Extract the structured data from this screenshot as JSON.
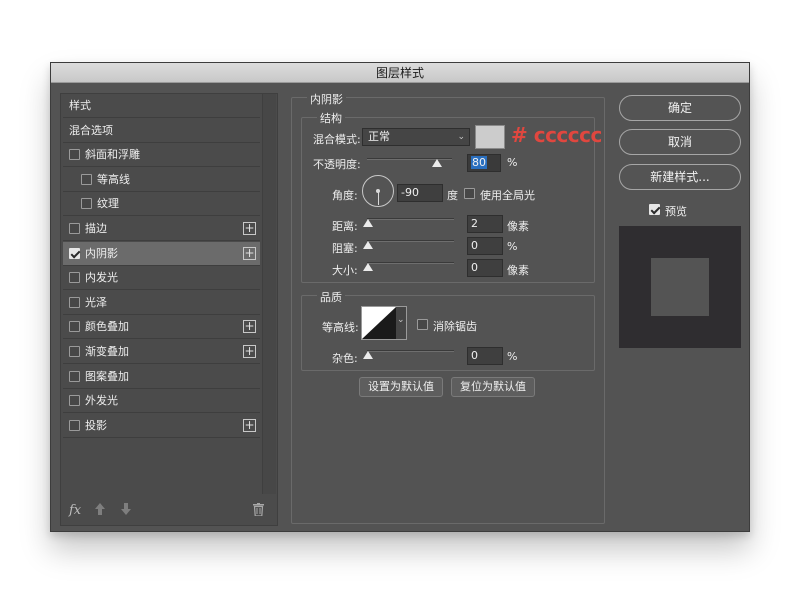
{
  "dialog": {
    "title": "图层样式"
  },
  "left_panel": {
    "items": [
      {
        "label": "样式",
        "checkbox": false,
        "plus": false
      },
      {
        "label": "混合选项",
        "checkbox": false,
        "plus": false
      },
      {
        "label": "斜面和浮雕",
        "checkbox": true,
        "checked": false,
        "plus": false
      },
      {
        "label": "等高线",
        "checkbox": true,
        "checked": false,
        "plus": false,
        "indent": true
      },
      {
        "label": "纹理",
        "checkbox": true,
        "checked": false,
        "plus": false,
        "indent": true
      },
      {
        "label": "描边",
        "checkbox": true,
        "checked": false,
        "plus": true
      },
      {
        "label": "内阴影",
        "checkbox": true,
        "checked": true,
        "plus": true,
        "selected": true
      },
      {
        "label": "内发光",
        "checkbox": true,
        "checked": false,
        "plus": false
      },
      {
        "label": "光泽",
        "checkbox": true,
        "checked": false,
        "plus": false
      },
      {
        "label": "颜色叠加",
        "checkbox": true,
        "checked": false,
        "plus": true
      },
      {
        "label": "渐变叠加",
        "checkbox": true,
        "checked": false,
        "plus": true
      },
      {
        "label": "图案叠加",
        "checkbox": true,
        "checked": false,
        "plus": false
      },
      {
        "label": "外发光",
        "checkbox": true,
        "checked": false,
        "plus": false
      },
      {
        "label": "投影",
        "checkbox": true,
        "checked": false,
        "plus": true
      }
    ],
    "fx_label": "fx",
    "icons": [
      "fx-icon",
      "move-up-icon",
      "move-down-icon",
      "trash-icon"
    ]
  },
  "inner_shadow": {
    "section_title": "内阴影",
    "structure_title": "结构",
    "blend_mode_label": "混合模式:",
    "blend_mode_value": "正常",
    "color_swatch": "#cccccc",
    "color_annotation": "# cccccc",
    "opacity_label": "不透明度:",
    "opacity_value": "80",
    "opacity": 80,
    "opacity_unit": "%",
    "angle_label": "角度:",
    "angle_value": "-90",
    "angle_unit": "度",
    "global_light_label": "使用全局光",
    "global_light_checked": false,
    "distance_label": "距离:",
    "distance_value": "2",
    "distance_unit": "像素",
    "choke_label": "阻塞:",
    "choke_value": "0",
    "choke_unit": "%",
    "size_label": "大小:",
    "size_value": "0",
    "size_unit": "像素"
  },
  "quality": {
    "title": "品质",
    "contour_label": "等高线:",
    "anti_alias_label": "消除锯齿",
    "anti_alias_checked": false,
    "noise_label": "杂色:",
    "noise_value": "0",
    "noise_unit": "%"
  },
  "buttons": {
    "make_default": "设置为默认值",
    "reset_default": "复位为默认值",
    "ok": "确定",
    "cancel": "取消",
    "new_style": "新建样式...",
    "preview_label": "预览",
    "preview_checked": true
  },
  "colors": {
    "dialog_bg": "#535353",
    "annotation_red": "#e0473f",
    "highlight_blue": "#2a6fbf",
    "preview_bg": "#2f2d30"
  }
}
